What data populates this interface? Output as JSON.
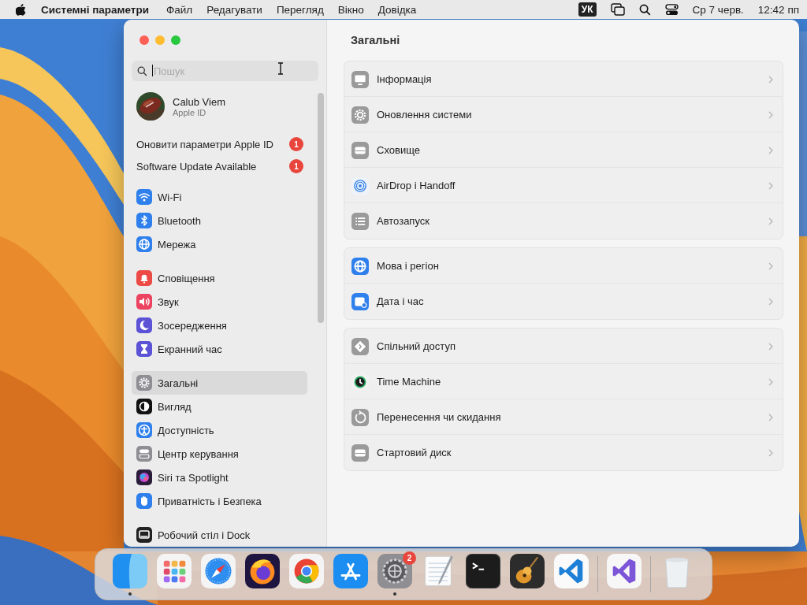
{
  "menu_bar": {
    "app_name": "Системні параметри",
    "menus": [
      "Файл",
      "Редагувати",
      "Перегляд",
      "Вікно",
      "Довідка"
    ],
    "input_source": "УК",
    "date": "Ср 7 черв.",
    "time": "12:42 пп"
  },
  "sidebar": {
    "search": {
      "placeholder": "Пошук",
      "focused": true
    },
    "account": {
      "name": "Calub Viem",
      "subtitle": "Apple ID"
    },
    "notices": [
      {
        "text": "Оновити параметри Apple ID",
        "badge": "1"
      },
      {
        "text": "Software Update Available",
        "badge": "1"
      }
    ],
    "groups": [
      [
        {
          "label": "Wi-Fi",
          "selected": false
        },
        {
          "label": "Bluetooth",
          "selected": false
        },
        {
          "label": "Мережа",
          "selected": false
        }
      ],
      [
        {
          "label": "Сповіщення",
          "selected": false
        },
        {
          "label": "Звук",
          "selected": false
        },
        {
          "label": "Зосередження",
          "selected": false
        },
        {
          "label": "Екранний час",
          "selected": false
        }
      ],
      [
        {
          "label": "Загальні",
          "selected": true
        },
        {
          "label": "Вигляд",
          "selected": false
        },
        {
          "label": "Доступність",
          "selected": false
        },
        {
          "label": "Центр керування",
          "selected": false
        },
        {
          "label": "Siri та Spotlight",
          "selected": false
        },
        {
          "label": "Приватність і Безпека",
          "selected": false
        }
      ],
      [
        {
          "label": "Робочий стіл і Dock",
          "selected": false
        }
      ]
    ]
  },
  "content": {
    "title": "Загальні",
    "groups": [
      [
        "Інформація",
        "Оновлення системи",
        "Сховище",
        "AirDrop і Handoff",
        "Автозапуск"
      ],
      [
        "Мова і регіон",
        "Дата і час"
      ],
      [
        "Спільний доступ",
        "Time Machine",
        "Перенесення чи скидання",
        "Стартовий диск"
      ]
    ]
  },
  "dock": {
    "items": [
      {
        "kind": "app",
        "running": true
      },
      {
        "kind": "app",
        "running": false
      },
      {
        "kind": "app",
        "running": false
      },
      {
        "kind": "app",
        "running": false
      },
      {
        "kind": "app",
        "running": false
      },
      {
        "kind": "app",
        "running": false
      },
      {
        "kind": "app",
        "running": true,
        "badge": "2"
      },
      {
        "kind": "app",
        "running": false
      },
      {
        "kind": "app",
        "running": false
      },
      {
        "kind": "app",
        "running": false
      },
      {
        "kind": "app",
        "running": false
      },
      {
        "kind": "separator"
      },
      {
        "kind": "app",
        "running": false
      },
      {
        "kind": "separator"
      },
      {
        "kind": "app",
        "running": false
      }
    ]
  }
}
